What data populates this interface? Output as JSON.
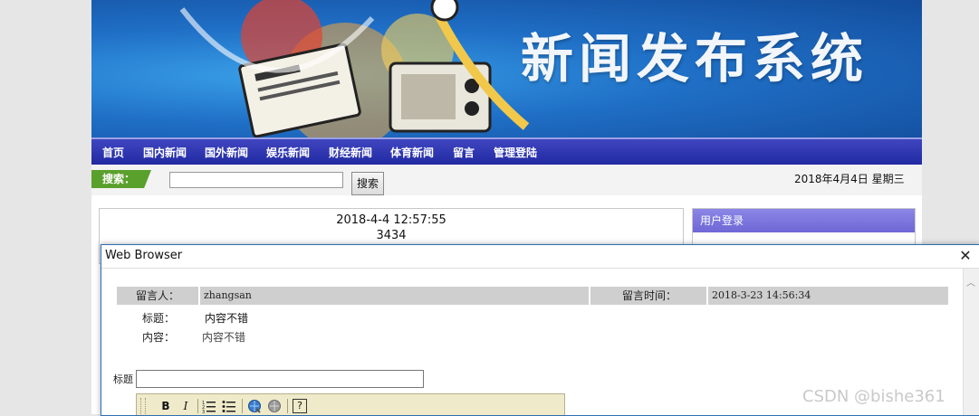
{
  "banner": {
    "title": "新闻发布系统"
  },
  "nav": {
    "items": [
      "首页",
      "国内新闻",
      "国外新闻",
      "娱乐新闻",
      "财经新闻",
      "体育新闻",
      "留言",
      "管理登陆"
    ]
  },
  "search": {
    "label": "搜索：",
    "input_value": "",
    "button_label": "搜索"
  },
  "header_date": "2018年4月4日 星期三",
  "news": {
    "time": "2018-4-4 12:57:55",
    "count": "3434"
  },
  "login": {
    "header": "用户登录"
  },
  "dialog": {
    "title": "Web Browser",
    "close_icon": "close-icon",
    "message": {
      "author_label": "留言人：",
      "author": "zhangsan",
      "time_label": "留言时间：",
      "time": "2018-3-23 14:56:34",
      "title_label": "标题：",
      "title": "内容不错",
      "content_label": "内容：",
      "content": "内容不错"
    },
    "form": {
      "title_label": "标题",
      "title_value": ""
    },
    "toolbar": {
      "bold": "B",
      "italic": "I",
      "help": "?"
    }
  },
  "watermark": "CSDN @bishe361",
  "colors": {
    "nav_bg": "#2a31aa",
    "search_label_bg": "#5aa02c",
    "login_header_bg": "#7b75de",
    "dialog_border": "#2f6fb1"
  }
}
